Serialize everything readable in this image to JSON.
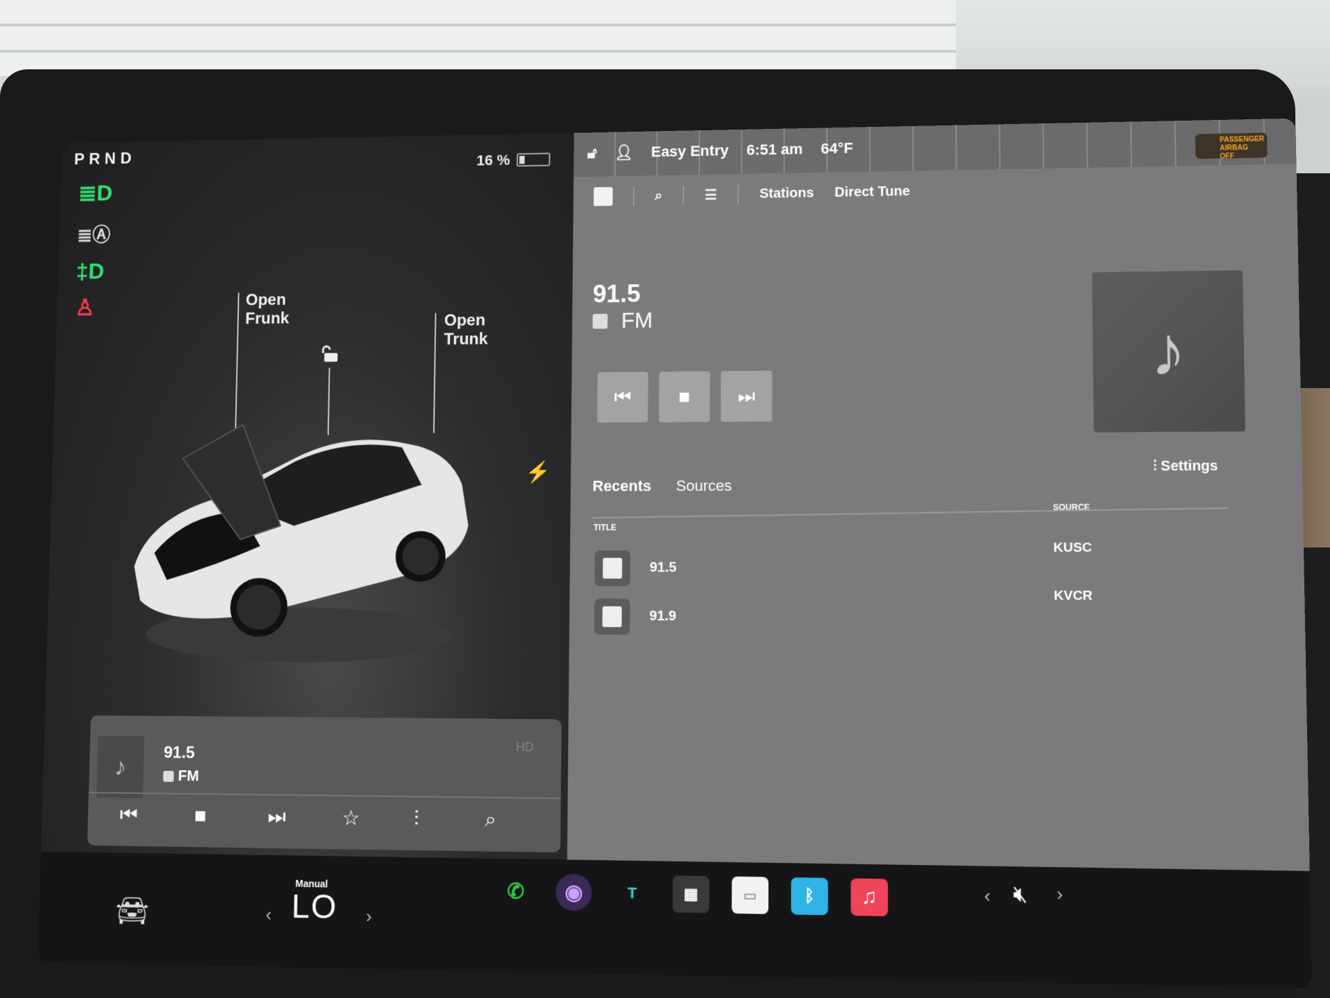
{
  "gear": {
    "label": "PRND"
  },
  "battery": {
    "percent_label": "16 %",
    "level": 0.16
  },
  "car": {
    "open_frunk": [
      "Open",
      "Frunk"
    ],
    "open_trunk": [
      "Open",
      "Trunk"
    ]
  },
  "status_bar": {
    "profile": "Easy Entry",
    "time": "6:51 am",
    "temperature": "64°F",
    "airbag": "PASSENGER AIRBAG OFF"
  },
  "toolbar": {
    "stations": "Stations",
    "direct_tune": "Direct Tune"
  },
  "now_playing": {
    "frequency": "91.5",
    "band": "FM"
  },
  "tabs": {
    "recents": "Recents",
    "sources": "Sources",
    "settings": "Settings"
  },
  "table": {
    "col_title": "TITLE",
    "col_source": "SOURCE",
    "rows": [
      {
        "title": "91.5",
        "source": "KUSC"
      },
      {
        "title": "91.9",
        "source": "KVCR"
      }
    ]
  },
  "mini_player": {
    "frequency": "91.5",
    "band": "FM"
  },
  "climate": {
    "mode": "Manual",
    "temp": "LO"
  },
  "colors": {
    "tell_green": "#2ee06a",
    "tell_red": "#ff3b4a",
    "media_bg": "#7b7b7d",
    "phone_green": "#2ecc40"
  },
  "icons": [
    "headlight-icon",
    "auto-headlight-icon",
    "fog-light-icon",
    "seatbelt-icon",
    "lock-icon",
    "bolt-icon",
    "search-icon",
    "queue-icon",
    "music-note-icon",
    "phone-icon",
    "camera-icon",
    "toybox-icon",
    "apps-icon",
    "radio-icon",
    "bluetooth-icon",
    "music-icon",
    "mute-icon"
  ]
}
